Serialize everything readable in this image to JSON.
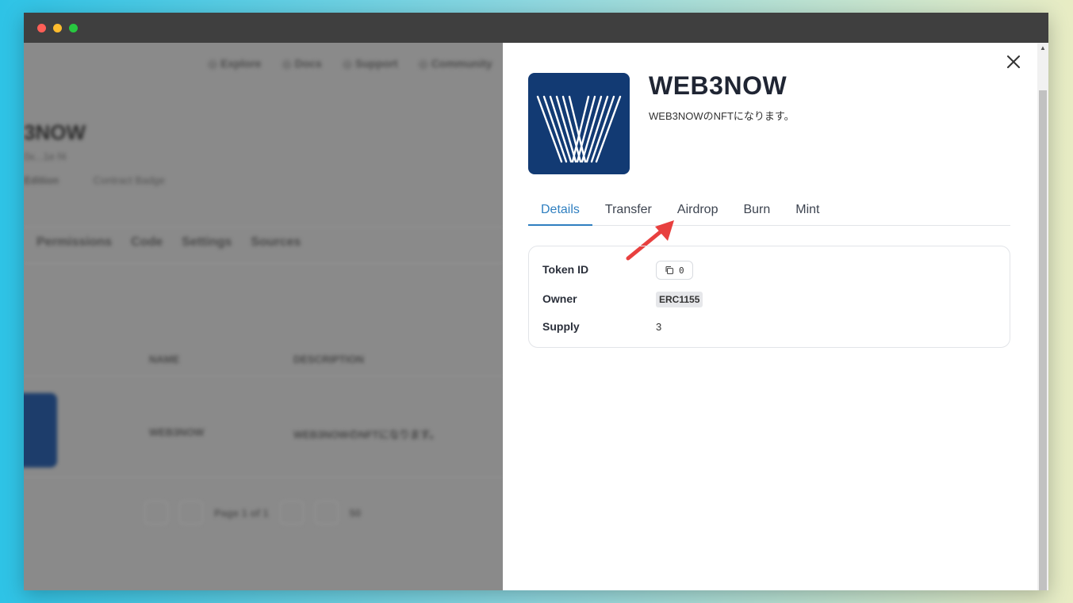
{
  "background_page": {
    "nav": [
      "Explore",
      "Docs",
      "Support",
      "Community"
    ],
    "title": "3NOW",
    "subtitle": "0x...1e f4",
    "meta": [
      "Edition",
      "Contract Badge"
    ],
    "tabs": [
      "Permissions",
      "Code",
      "Settings",
      "Sources"
    ],
    "columns": [
      "NAME",
      "DESCRIPTION"
    ],
    "row": {
      "name": "WEB3NOW",
      "description": "WEB3NOWのNFTになります。"
    },
    "pager": {
      "label": "Page 1 of 1",
      "per_page": "50"
    }
  },
  "drawer": {
    "nft_name": "WEB3NOW",
    "nft_description": "WEB3NOWのNFTになります。",
    "tabs": [
      {
        "label": "Details",
        "active": true
      },
      {
        "label": "Transfer",
        "active": false
      },
      {
        "label": "Airdrop",
        "active": false
      },
      {
        "label": "Burn",
        "active": false
      },
      {
        "label": "Mint",
        "active": false
      }
    ],
    "details": {
      "token_id_label": "Token ID",
      "token_id_value": "0",
      "owner_label": "Owner",
      "owner_value": "ERC1155",
      "supply_label": "Supply",
      "supply_value": "3"
    }
  },
  "icons": {
    "close": "close-icon",
    "copy": "copy-icon",
    "logo": "web3now-logo"
  },
  "colors": {
    "accent": "#2f7fc0",
    "logo_bg": "#123a73",
    "annotation_arrow": "#e8403f"
  }
}
